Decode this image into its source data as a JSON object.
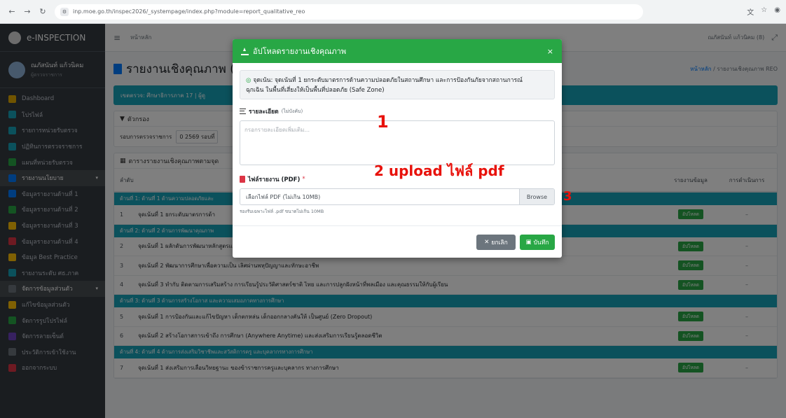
{
  "browser": {
    "url": "inp.moe.go.th/inspec2026/_systempage/index.php?module=report_qualitative_reo"
  },
  "sidebar": {
    "brand": "e-INSPECTION",
    "user_name": "ณภัสนันท์ แก้วนิคม",
    "user_sub": "ผู้ตรวจราชการ",
    "items": [
      {
        "label": "Dashboard",
        "color": "#e0a800"
      },
      {
        "label": "โปรไฟล์",
        "color": "#17a2b8"
      },
      {
        "label": "รายการหน่วยรับตรวจ",
        "color": "#17a2b8"
      },
      {
        "label": "ปฏิทินการตรวจราชการ",
        "color": "#17a2b8"
      },
      {
        "label": "แผนที่หน่วยรับตรวจ",
        "color": "#28a745"
      },
      {
        "label": "รายงานนโยบาย",
        "color": "#007bff"
      },
      {
        "label": "ข้อมูลรายงานด้านที่ 1",
        "color": "#007bff"
      },
      {
        "label": "ข้อมูลรายงานด้านที่ 2",
        "color": "#28a745"
      },
      {
        "label": "ข้อมูลรายงานด้านที่ 3",
        "color": "#ffc107"
      },
      {
        "label": "ข้อมูลรายงานด้านที่ 4",
        "color": "#dc3545"
      },
      {
        "label": "ข้อมูล Best Practice",
        "color": "#ffc107"
      },
      {
        "label": "รายงานระดับ ศธ.ภาค",
        "color": "#17a2b8"
      },
      {
        "label": "จัดการข้อมูลส่วนตัว",
        "color": "#6c757d"
      },
      {
        "label": "แก้ไขข้อมูลส่วนตัว",
        "color": "#ffc107"
      },
      {
        "label": "จัดการรูปโปรไฟล์",
        "color": "#28a745"
      },
      {
        "label": "จัดการลายเซ็นต์",
        "color": "#6f42c1"
      },
      {
        "label": "ประวัติการเข้าใช้งาน",
        "color": "#6c757d"
      },
      {
        "label": "ออกจากระบบ",
        "color": "#dc3545"
      }
    ]
  },
  "topnav": {
    "home": "หน้าหลัก",
    "user": "ณภัสนันท์ แก้วนิคม (8)"
  },
  "page": {
    "title": "รายงานเชิงคุณภาพ (",
    "crumb_home": "หน้าหลัก",
    "crumb_current": "/ รายงานเชิงคุณภาพ REO",
    "teal_bar": "เขตตรวจ: ศึกษาธิการภาค 17 | ผู้ดู",
    "filter_title": "ตัวกรอง",
    "filter_round_label": "รอบการตรวจราชการ",
    "filter_round_value": "0 2569 รอบที่",
    "table_title": "ตารางรายงานเชิงคุณภาพตามจุด",
    "col_no": "ลำดับ",
    "col_report": "รายงานข้อมูล",
    "col_action": "การดำเนินการ"
  },
  "table": {
    "upload_label": "อัปโหลด",
    "dash": "–",
    "groups": [
      {
        "title": "ด้านที่ 1: ด้านที่ 1 ด้านความปลอดภัยและ",
        "rows": [
          {
            "no": "1",
            "text": "จุดเน้นที่ 1 ยกระดับมาตรการด้า"
          }
        ]
      },
      {
        "title": "ด้านที่ 2: ด้านที่ 2 ด้านการพัฒนาคุณภาพ",
        "rows": [
          {
            "no": "2",
            "text": "จุดเน้นที่ 1 ผลักดันการพัฒนาหลักสูตรและกระบวนการเรียนรู้ที่ตอบโจทย์บริบทพื้นที่ โดยเน้นสมรรถนะ ที่จำเป็นให้กับผู้เรียนได้เต็มตามศักยภาพ"
          },
          {
            "no": "3",
            "text": "จุดเน้นที่ 2 พัฒนาการศึกษาเพื่อความเป็น เลิศผ่านพหุปัญญาและทักษะอาชีพ"
          },
          {
            "no": "4",
            "text": "จุดเน้นที่ 3 ทำกับ ติดตามการเสริมสร้าง การเรียนรู้ประวัติศาสตร์ชาติ ไทย และการปลูกฝังหน้าที่พลเมือง และคุณธรรมให้กับผู้เรียน"
          }
        ]
      },
      {
        "title": "ด้านที่ 3: ด้านที่ 3 ด้านการสร้างโอกาส และความเสมอภาคทางการศึกษา",
        "rows": [
          {
            "no": "5",
            "text": "จุดเน้นที่ 1 การป้องกันและแก้ไขปัญหา เด็กตกหล่น เด็กออกกลางคันให้ เป็นศูนย์ (Zero Dropout)"
          },
          {
            "no": "6",
            "text": "จุดเน้นที่ 2 สร้างโอกาสการเข้าถึง การศึกษา (Anywhere Anytime) และส่งเสริมการเรียนรู้ตลอดชีวิต"
          }
        ]
      },
      {
        "title": "ด้านที่ 4: ด้านที่ 4 ด้านการส่งเสริมวิชาชีพและสวัสดิการครู และบุคลากรทางการศึกษา",
        "rows": [
          {
            "no": "7",
            "text": "จุดเน้นที่ 1 ส่งเสริมการเลื่อนวิทยฐานะ ของข้าราชการครูและบุคลากร ทางการศึกษา"
          }
        ]
      }
    ]
  },
  "modal": {
    "title": "อัปโหลดรายงานเชิงคุณภาพ",
    "close": "×",
    "info_line1": "จุดเน้น: จุดเน้นที่ 1 ยกระดับมาตรการด้านความปลอดภัยในสถานศึกษา และการป้องกันภัยจากสถานการณ์",
    "info_line2": "ฉุกเฉิน ในพื้นที่เสี่ยงให้เป็นพื้นที่ปลอดภัย (Safe Zone)",
    "detail_label": "รายละเอียด",
    "detail_optional": "(ไม่บังคับ)",
    "detail_placeholder": "กรอกรายละเอียดเพิ่มเติม...",
    "file_label": "ไฟล์รายงาน (PDF)",
    "file_required": "*",
    "file_placeholder": "เลือกไฟล์ PDF (ไม่เกิน 10MB)",
    "browse": "Browse",
    "help": "รองรับเฉพาะไฟล์ .pdf ขนาดไม่เกิน 10MB",
    "cancel": "ยกเลิก",
    "save": "บันทึก"
  },
  "annotations": {
    "a1": "1",
    "a2": "2 upload ไฟล์ pdf",
    "a3": "3"
  }
}
